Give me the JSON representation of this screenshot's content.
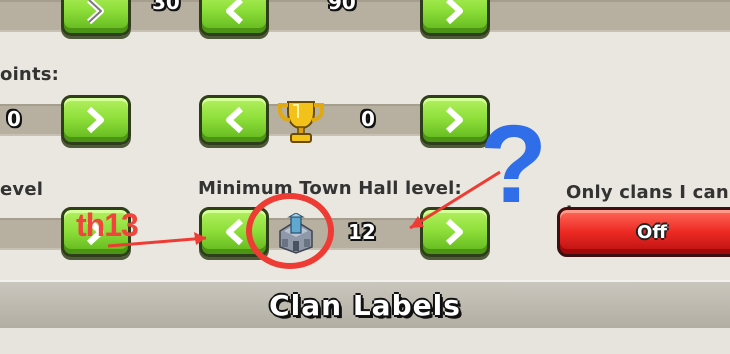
{
  "labels": {
    "points": "oints:",
    "level": "evel",
    "min_th": "Minimum Town Hall level:",
    "only_clans": "Only clans I can jo"
  },
  "values": {
    "top_a": "30",
    "top_b": "90",
    "points_value": "0",
    "trophy_value": "0",
    "th_value": "12"
  },
  "buttons": {
    "off_label": "Off"
  },
  "footer": {
    "title": "Clan Labels"
  },
  "annotations": {
    "text": "th13",
    "question": "?"
  },
  "icons": {
    "trophy": "trophy-icon",
    "town_hall": "town-hall-icon"
  },
  "colors": {
    "green_button": "#8fe03b",
    "red_button": "#ec2a23",
    "annotation_red": "#ee3b33",
    "annotation_blue": "#2f6ee8"
  }
}
